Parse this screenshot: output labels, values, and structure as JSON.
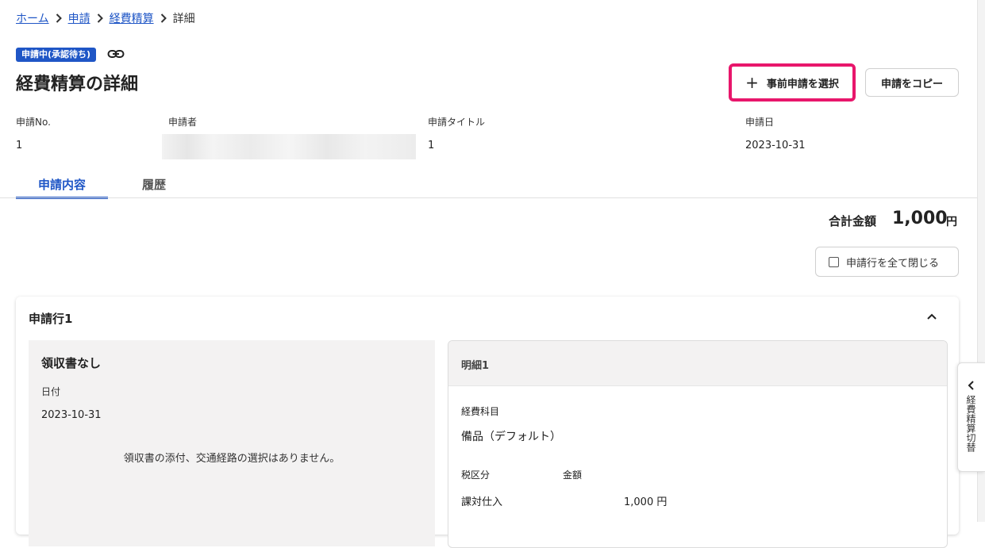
{
  "breadcrumb": {
    "items": [
      "ホーム",
      "申請",
      "経費精算"
    ],
    "current": "詳細"
  },
  "status_badge": "申請中(承認待ち)",
  "page_title": "経費精算の詳細",
  "actions": {
    "select_pre_application": "事前申請を選択",
    "copy_application": "申請をコピー"
  },
  "meta": {
    "labels": {
      "application_no": "申請No.",
      "applicant": "申請者",
      "application_title": "申請タイトル",
      "application_date": "申請日"
    },
    "values": {
      "application_no": "1",
      "applicant": "",
      "application_title": "1",
      "application_date": "2023-10-31"
    }
  },
  "tabs": [
    "申請内容",
    "履歴"
  ],
  "total": {
    "label": "合計金額",
    "amount": "1,000",
    "unit": "円"
  },
  "collapse_all_label": "申請行を全て閉じる",
  "line": {
    "title": "申請行1",
    "receipt": {
      "title": "領収書なし",
      "date_label": "日付",
      "date": "2023-10-31",
      "message": "領収書の添付、交通経路の選択はありません。"
    },
    "detail": {
      "title": "明細1",
      "account_label": "経費科目",
      "account_value": "備品（デフォルト）",
      "tax_label": "税区分",
      "amount_label": "金額",
      "tax_value": "課対仕入",
      "amount_value": "1,000 円"
    }
  },
  "side_tab_label": "経費精算切替",
  "colors": {
    "accent": "#1f56c6",
    "highlight": "#e8166b"
  }
}
